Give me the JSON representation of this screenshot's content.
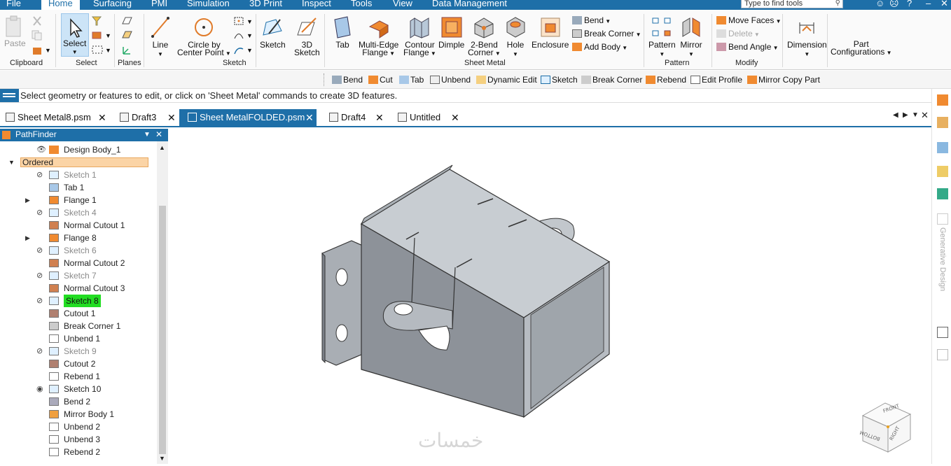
{
  "menu": {
    "items": [
      "File",
      "Home",
      "Surfacing",
      "PMI",
      "Simulation",
      "3D Print",
      "Inspect",
      "Tools",
      "View",
      "Data Management"
    ],
    "active": "Home",
    "search_placeholder": "Type to find tools"
  },
  "ribbon": {
    "clipboard": {
      "paste": "Paste",
      "group": "Clipboard"
    },
    "select": {
      "select": "Select",
      "group": "Select"
    },
    "planes": {
      "group": "Planes"
    },
    "sketch": {
      "line": "Line",
      "circle1": "Circle by",
      "circle2": "Center Point",
      "group": "Sketch"
    },
    "sketch_tools": {
      "sketch": "Sketch",
      "sketch3d_1": "3D",
      "sketch3d_2": "Sketch"
    },
    "sheet_metal": {
      "tab": "Tab",
      "multi1": "Multi-Edge",
      "multi2": "Flange",
      "contour1": "Contour",
      "contour2": "Flange",
      "dimple": "Dimple",
      "bend2_1": "2-Bend",
      "bend2_2": "Corner",
      "hole": "Hole",
      "enclosure": "Enclosure",
      "bend": "Bend",
      "break_corner": "Break Corner",
      "add_body": "Add Body",
      "group": "Sheet Metal"
    },
    "pattern": {
      "pattern": "Pattern",
      "mirror": "Mirror",
      "group": "Pattern"
    },
    "modify": {
      "move_faces": "Move Faces",
      "delete": "Delete",
      "bend_angle": "Bend Angle",
      "group": "Modify"
    },
    "dimension": {
      "dimension": "Dimension"
    },
    "part_config": {
      "l1": "Part",
      "l2": "Configurations"
    }
  },
  "command_bar": [
    "Bend",
    "Cut",
    "Tab",
    "Unbend",
    "Dynamic Edit",
    "Sketch",
    "Break Corner",
    "Rebend",
    "Edit Profile",
    "Mirror Copy Part"
  ],
  "prompt": "Select geometry or features to edit, or click on 'Sheet Metal' commands to create 3D features.",
  "tabs": [
    {
      "label": "Sheet Metal8.psm",
      "active": false
    },
    {
      "label": "Draft3",
      "active": false
    },
    {
      "label": "Sheet MetalFOLDED.psm",
      "active": true
    },
    {
      "label": "Draft4",
      "active": false
    },
    {
      "label": "Untitled",
      "active": false
    }
  ],
  "pathfinder": {
    "title": "PathFinder",
    "design_body": "Design Body_1",
    "ordered": "Ordered",
    "items": [
      {
        "label": "Sketch 1",
        "dim": true,
        "eye": "hidden"
      },
      {
        "label": "Tab 1",
        "dim": false,
        "eye": ""
      },
      {
        "label": "Flange 1",
        "dim": false,
        "eye": "",
        "expand": true
      },
      {
        "label": "Sketch 4",
        "dim": true,
        "eye": "hidden"
      },
      {
        "label": "Normal Cutout 1",
        "dim": false,
        "eye": ""
      },
      {
        "label": "Flange 8",
        "dim": false,
        "eye": "",
        "expand": true
      },
      {
        "label": "Sketch 6",
        "dim": true,
        "eye": "hidden"
      },
      {
        "label": "Normal Cutout 2",
        "dim": false,
        "eye": ""
      },
      {
        "label": "Sketch 7",
        "dim": true,
        "eye": "hidden"
      },
      {
        "label": "Normal Cutout 3",
        "dim": false,
        "eye": ""
      },
      {
        "label": "Sketch 8",
        "dim": false,
        "eye": "hidden",
        "highlight": true
      },
      {
        "label": "Cutout 1",
        "dim": false,
        "eye": ""
      },
      {
        "label": "Break Corner 1",
        "dim": false,
        "eye": ""
      },
      {
        "label": "Unbend 1",
        "dim": false,
        "eye": ""
      },
      {
        "label": "Sketch 9",
        "dim": true,
        "eye": "hidden"
      },
      {
        "label": "Cutout 2",
        "dim": false,
        "eye": ""
      },
      {
        "label": "Rebend 1",
        "dim": false,
        "eye": ""
      },
      {
        "label": "Sketch 10",
        "dim": false,
        "eye": "visible"
      },
      {
        "label": "Bend 2",
        "dim": false,
        "eye": ""
      },
      {
        "label": "Mirror Body 1",
        "dim": false,
        "eye": ""
      },
      {
        "label": "Unbend 2",
        "dim": false,
        "eye": ""
      },
      {
        "label": "Unbend 3",
        "dim": false,
        "eye": ""
      },
      {
        "label": "Rebend 2",
        "dim": false,
        "eye": ""
      }
    ]
  },
  "side": {
    "generative": "Generative Design"
  },
  "viewcube": {
    "front": "FRONT",
    "right": "RIGHT",
    "bottom": "BOTTOM"
  },
  "watermark": "خمسات"
}
